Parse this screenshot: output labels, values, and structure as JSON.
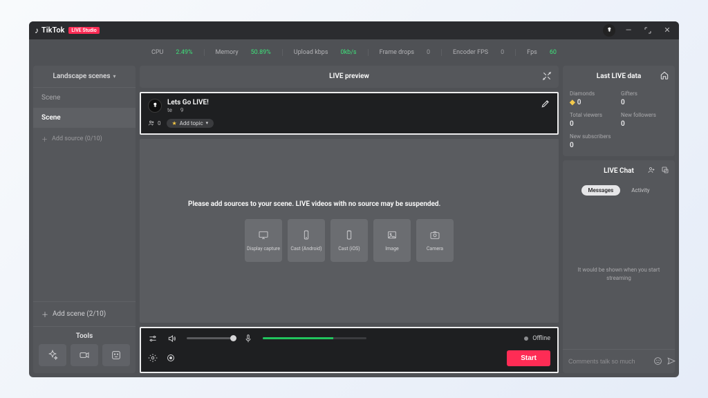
{
  "app": {
    "name": "TikTok",
    "badge": "LIVE Studio"
  },
  "stats_bar": [
    {
      "label": "CPU",
      "value": "2.49%",
      "style": "green"
    },
    {
      "label": "Memory",
      "value": "50.89%",
      "style": "green"
    },
    {
      "label": "Upload kbps",
      "value": "0kb/s",
      "style": "green"
    },
    {
      "label": "Frame drops",
      "value": "0",
      "style": "dim"
    },
    {
      "label": "Encoder FPS",
      "value": "0",
      "style": "dim"
    },
    {
      "label": "Fps",
      "value": "60",
      "style": "green"
    }
  ],
  "sidebar": {
    "header": "Landscape scenes",
    "scenes": [
      "Scene",
      "Scene"
    ],
    "active_scene_index": 1,
    "add_source": "Add source (0/10)",
    "add_scene": "Add scene (2/10)",
    "tools_title": "Tools"
  },
  "center": {
    "header": "LIVE preview",
    "info": {
      "title": "Lets Go LIVE!",
      "sub_left": "te",
      "sub_right": "9",
      "viewers": "0",
      "topic_chip": "Add topic"
    },
    "preview_prompt": "Please add sources to your scene. LIVE videos with no source may be suspended.",
    "source_cards": [
      "Display capture",
      "Cast (Android)",
      "Cast (iOS)",
      "Image",
      "Camera"
    ]
  },
  "controls": {
    "status": "Offline",
    "start": "Start"
  },
  "right": {
    "data_header": "Last LIVE data",
    "metrics": [
      {
        "label": "Diamonds",
        "value": "0",
        "icon": "diamond"
      },
      {
        "label": "Gifters",
        "value": "0"
      },
      {
        "label": "Total viewers",
        "value": "0"
      },
      {
        "label": "New followers",
        "value": "0"
      },
      {
        "label": "New subscribers",
        "value": "0"
      }
    ],
    "chat_header": "LIVE Chat",
    "chat_tabs": [
      "Messages",
      "Activity"
    ],
    "chat_active_tab": 0,
    "chat_empty": "It would be shown when you start streaming",
    "chat_placeholder": "Comments talk so much"
  }
}
